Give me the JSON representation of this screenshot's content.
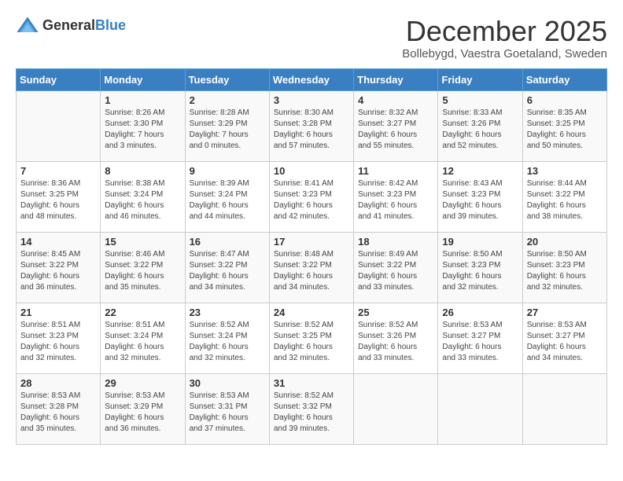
{
  "header": {
    "logo_general": "General",
    "logo_blue": "Blue",
    "title": "December 2025",
    "subtitle": "Bollebygd, Vaestra Goetaland, Sweden"
  },
  "days_of_week": [
    "Sunday",
    "Monday",
    "Tuesday",
    "Wednesday",
    "Thursday",
    "Friday",
    "Saturday"
  ],
  "weeks": [
    [
      {
        "day": "",
        "sunrise": "",
        "sunset": "",
        "daylight": ""
      },
      {
        "day": "1",
        "sunrise": "Sunrise: 8:26 AM",
        "sunset": "Sunset: 3:30 PM",
        "daylight": "Daylight: 7 hours and 3 minutes."
      },
      {
        "day": "2",
        "sunrise": "Sunrise: 8:28 AM",
        "sunset": "Sunset: 3:29 PM",
        "daylight": "Daylight: 7 hours and 0 minutes."
      },
      {
        "day": "3",
        "sunrise": "Sunrise: 8:30 AM",
        "sunset": "Sunset: 3:28 PM",
        "daylight": "Daylight: 6 hours and 57 minutes."
      },
      {
        "day": "4",
        "sunrise": "Sunrise: 8:32 AM",
        "sunset": "Sunset: 3:27 PM",
        "daylight": "Daylight: 6 hours and 55 minutes."
      },
      {
        "day": "5",
        "sunrise": "Sunrise: 8:33 AM",
        "sunset": "Sunset: 3:26 PM",
        "daylight": "Daylight: 6 hours and 52 minutes."
      },
      {
        "day": "6",
        "sunrise": "Sunrise: 8:35 AM",
        "sunset": "Sunset: 3:25 PM",
        "daylight": "Daylight: 6 hours and 50 minutes."
      }
    ],
    [
      {
        "day": "7",
        "sunrise": "Sunrise: 8:36 AM",
        "sunset": "Sunset: 3:25 PM",
        "daylight": "Daylight: 6 hours and 48 minutes."
      },
      {
        "day": "8",
        "sunrise": "Sunrise: 8:38 AM",
        "sunset": "Sunset: 3:24 PM",
        "daylight": "Daylight: 6 hours and 46 minutes."
      },
      {
        "day": "9",
        "sunrise": "Sunrise: 8:39 AM",
        "sunset": "Sunset: 3:24 PM",
        "daylight": "Daylight: 6 hours and 44 minutes."
      },
      {
        "day": "10",
        "sunrise": "Sunrise: 8:41 AM",
        "sunset": "Sunset: 3:23 PM",
        "daylight": "Daylight: 6 hours and 42 minutes."
      },
      {
        "day": "11",
        "sunrise": "Sunrise: 8:42 AM",
        "sunset": "Sunset: 3:23 PM",
        "daylight": "Daylight: 6 hours and 41 minutes."
      },
      {
        "day": "12",
        "sunrise": "Sunrise: 8:43 AM",
        "sunset": "Sunset: 3:23 PM",
        "daylight": "Daylight: 6 hours and 39 minutes."
      },
      {
        "day": "13",
        "sunrise": "Sunrise: 8:44 AM",
        "sunset": "Sunset: 3:22 PM",
        "daylight": "Daylight: 6 hours and 38 minutes."
      }
    ],
    [
      {
        "day": "14",
        "sunrise": "Sunrise: 8:45 AM",
        "sunset": "Sunset: 3:22 PM",
        "daylight": "Daylight: 6 hours and 36 minutes."
      },
      {
        "day": "15",
        "sunrise": "Sunrise: 8:46 AM",
        "sunset": "Sunset: 3:22 PM",
        "daylight": "Daylight: 6 hours and 35 minutes."
      },
      {
        "day": "16",
        "sunrise": "Sunrise: 8:47 AM",
        "sunset": "Sunset: 3:22 PM",
        "daylight": "Daylight: 6 hours and 34 minutes."
      },
      {
        "day": "17",
        "sunrise": "Sunrise: 8:48 AM",
        "sunset": "Sunset: 3:22 PM",
        "daylight": "Daylight: 6 hours and 34 minutes."
      },
      {
        "day": "18",
        "sunrise": "Sunrise: 8:49 AM",
        "sunset": "Sunset: 3:22 PM",
        "daylight": "Daylight: 6 hours and 33 minutes."
      },
      {
        "day": "19",
        "sunrise": "Sunrise: 8:50 AM",
        "sunset": "Sunset: 3:23 PM",
        "daylight": "Daylight: 6 hours and 32 minutes."
      },
      {
        "day": "20",
        "sunrise": "Sunrise: 8:50 AM",
        "sunset": "Sunset: 3:23 PM",
        "daylight": "Daylight: 6 hours and 32 minutes."
      }
    ],
    [
      {
        "day": "21",
        "sunrise": "Sunrise: 8:51 AM",
        "sunset": "Sunset: 3:23 PM",
        "daylight": "Daylight: 6 hours and 32 minutes."
      },
      {
        "day": "22",
        "sunrise": "Sunrise: 8:51 AM",
        "sunset": "Sunset: 3:24 PM",
        "daylight": "Daylight: 6 hours and 32 minutes."
      },
      {
        "day": "23",
        "sunrise": "Sunrise: 8:52 AM",
        "sunset": "Sunset: 3:24 PM",
        "daylight": "Daylight: 6 hours and 32 minutes."
      },
      {
        "day": "24",
        "sunrise": "Sunrise: 8:52 AM",
        "sunset": "Sunset: 3:25 PM",
        "daylight": "Daylight: 6 hours and 32 minutes."
      },
      {
        "day": "25",
        "sunrise": "Sunrise: 8:52 AM",
        "sunset": "Sunset: 3:26 PM",
        "daylight": "Daylight: 6 hours and 33 minutes."
      },
      {
        "day": "26",
        "sunrise": "Sunrise: 8:53 AM",
        "sunset": "Sunset: 3:27 PM",
        "daylight": "Daylight: 6 hours and 33 minutes."
      },
      {
        "day": "27",
        "sunrise": "Sunrise: 8:53 AM",
        "sunset": "Sunset: 3:27 PM",
        "daylight": "Daylight: 6 hours and 34 minutes."
      }
    ],
    [
      {
        "day": "28",
        "sunrise": "Sunrise: 8:53 AM",
        "sunset": "Sunset: 3:28 PM",
        "daylight": "Daylight: 6 hours and 35 minutes."
      },
      {
        "day": "29",
        "sunrise": "Sunrise: 8:53 AM",
        "sunset": "Sunset: 3:29 PM",
        "daylight": "Daylight: 6 hours and 36 minutes."
      },
      {
        "day": "30",
        "sunrise": "Sunrise: 8:53 AM",
        "sunset": "Sunset: 3:31 PM",
        "daylight": "Daylight: 6 hours and 37 minutes."
      },
      {
        "day": "31",
        "sunrise": "Sunrise: 8:52 AM",
        "sunset": "Sunset: 3:32 PM",
        "daylight": "Daylight: 6 hours and 39 minutes."
      },
      {
        "day": "",
        "sunrise": "",
        "sunset": "",
        "daylight": ""
      },
      {
        "day": "",
        "sunrise": "",
        "sunset": "",
        "daylight": ""
      },
      {
        "day": "",
        "sunrise": "",
        "sunset": "",
        "daylight": ""
      }
    ]
  ]
}
